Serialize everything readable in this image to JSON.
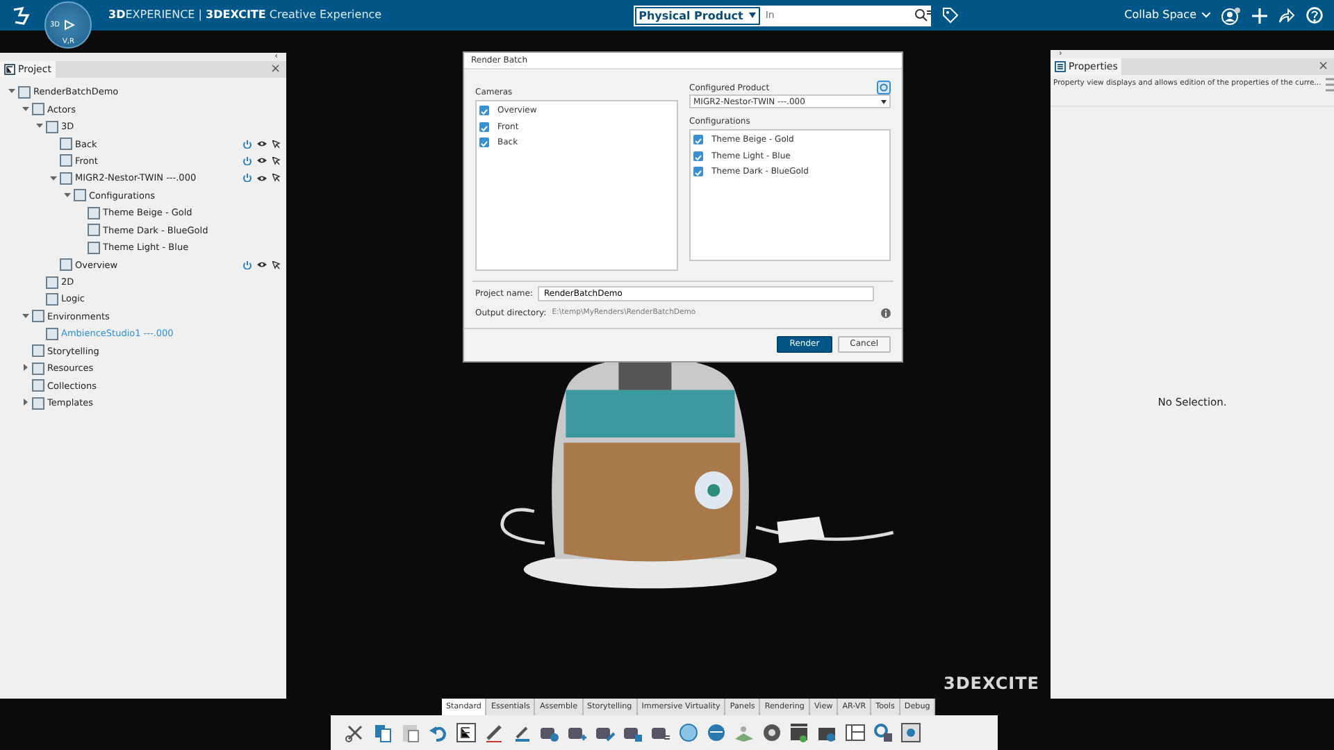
{
  "top_bar": {
    "compass": {
      "left": "3D",
      "bottom": "V,R"
    },
    "title": "**3D**EXPERIENCE | **3DEXCITE** Creative Experience",
    "search": {
      "scope": "Physical Product",
      "placeholder": "In"
    },
    "collab_space": "Collab Space"
  },
  "project_panel": {
    "collapse": "‹",
    "tab": "Project",
    "close": "×",
    "tree": [
      {
        "label": "RenderBatchDemo",
        "expanded": true,
        "highlighted": false,
        "children": [
          {
            "label": "Actors",
            "expanded": true,
            "highlighted": false,
            "children": [
              {
                "label": "3D",
                "expanded": true,
                "highlighted": false,
                "children": [
                  {
                    "label": "Back",
                    "highlighted": false,
                    "actions": true
                  },
                  {
                    "label": "Front",
                    "highlighted": false,
                    "actions": true
                  },
                  {
                    "label": "MIGR2-Nestor-TWIN ---.000",
                    "expanded": true,
                    "highlighted": false,
                    "actions": true,
                    "children": [
                      {
                        "label": "Configurations",
                        "expanded": true,
                        "highlighted": false,
                        "children": [
                          {
                            "label": "Theme Beige - Gold",
                            "highlighted": false
                          },
                          {
                            "label": "Theme Dark - BlueGold",
                            "highlighted": false
                          },
                          {
                            "label": "Theme Light - Blue",
                            "highlighted": false
                          }
                        ]
                      }
                    ]
                  },
                  {
                    "label": "Overview",
                    "highlighted": false,
                    "actions": true
                  }
                ]
              },
              {
                "label": "2D",
                "highlighted": false
              },
              {
                "label": "Logic",
                "highlighted": false
              }
            ]
          },
          {
            "label": "Environments",
            "expanded": true,
            "highlighted": false,
            "children": [
              {
                "label": "AmbienceStudio1 ---.000",
                "highlighted": true
              }
            ]
          },
          {
            "label": "Storytelling",
            "highlighted": false
          },
          {
            "label": "Resources",
            "expanded": false,
            "highlighted": false
          },
          {
            "label": "Collections",
            "highlighted": false
          },
          {
            "label": "Templates",
            "expanded": false,
            "highlighted": false
          }
        ]
      }
    ]
  },
  "dialog": {
    "title": "Render Batch",
    "cameras_label": "Cameras",
    "cameras": [
      {
        "label": "Overview",
        "checked": true
      },
      {
        "label": "Front",
        "checked": true
      },
      {
        "label": "Back",
        "checked": true
      }
    ],
    "product_label": "Configured Product",
    "product": "MIGR2-Nestor-TWIN ---.000",
    "configurations_label": "Configurations",
    "configurations": [
      {
        "label": "Theme Beige - Gold",
        "checked": true
      },
      {
        "label": "Theme Light - Blue",
        "checked": true
      },
      {
        "label": "Theme Dark - BlueGold",
        "checked": true
      }
    ],
    "project_name_label": "Project name:",
    "project_name": "RenderBatchDemo",
    "output_label": "Output directory:",
    "output_dir": "E:\\temp\\MyRenders\\RenderBatchDemo",
    "buttons": [
      {
        "label": "Render",
        "kind": "primary"
      },
      {
        "label": "Cancel",
        "kind": "secondary"
      }
    ]
  },
  "properties_panel": {
    "collapse": "›",
    "tab": "Properties",
    "close": "×",
    "description": "Property view displays and allows edition of the properties of the curre...",
    "empty": "No Selection."
  },
  "viewport": {
    "brand": "3DEXCITE"
  },
  "toolbar": {
    "tabs": [
      {
        "label": "Standard",
        "selected": true
      },
      {
        "label": "Essentials",
        "selected": false
      },
      {
        "label": "Assemble",
        "selected": false
      },
      {
        "label": "Storytelling",
        "selected": false
      },
      {
        "label": "Immersive Virtuality",
        "selected": false
      },
      {
        "label": "Panels",
        "selected": false
      },
      {
        "label": "Rendering",
        "selected": false
      },
      {
        "label": "View",
        "selected": false
      },
      {
        "label": "AR-VR",
        "selected": false
      },
      {
        "label": "Tools",
        "selected": false
      },
      {
        "label": "Debug",
        "selected": false
      }
    ]
  }
}
